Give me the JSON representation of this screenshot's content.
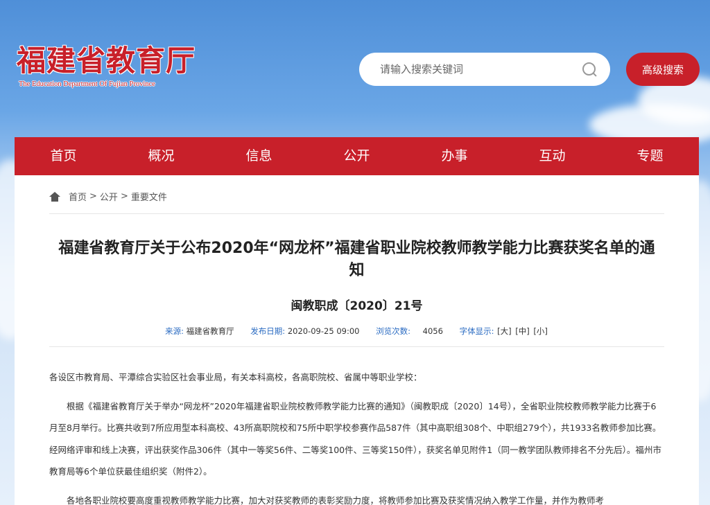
{
  "header": {
    "logo_cn": "福建省教育厅",
    "logo_en": "The Education Department Of Fujian Province",
    "search_placeholder": "请输入搜索关键词",
    "advanced_search_label": "高级搜索"
  },
  "nav": {
    "items": [
      "首页",
      "概况",
      "信息",
      "公开",
      "办事",
      "互动",
      "专题"
    ]
  },
  "breadcrumb": {
    "items": [
      "首页",
      "公开",
      "重要文件"
    ]
  },
  "article": {
    "title": "福建省教育厅关于公布2020年“网龙杯”福建省职业院校教师教学能力比赛获奖名单的通知",
    "doc_no": "闽教职成〔2020〕21号",
    "meta": {
      "source_label": "来源:",
      "source_value": "福建省教育厅",
      "date_label": "发布日期:",
      "date_value": "2020-09-25 09:00",
      "views_label": "浏览次数:",
      "views_value": "4056",
      "font_label": "字体显示:",
      "font_large": "[大]",
      "font_medium": "[中]",
      "font_small": "[小]"
    },
    "paragraphs": [
      "各设区市教育局、平潭综合实验区社会事业局，有关本科高校，各高职院校、省属中等职业学校：",
      "根据《福建省教育厅关于举办“网龙杯”2020年福建省职业院校教师教学能力比赛的通知》（闽教职成〔2020〕14号），全省职业院校教师教学能力比赛于6月至8月举行。比赛共收到7所应用型本科高校、43所高职院校和75所中职学校参赛作品587件（其中高职组308个、中职组279个），共1933名教师参加比赛。经网络评审和线上决赛，评出获奖作品306件（其中一等奖56件、二等奖100件、三等奖150件），获奖名单见附件1（同一教学团队教师排名不分先后）。福州市教育局等6个单位获最佳组织奖（附件2）。",
      "各地各职业院校要高度重视教师教学能力比赛，加大对获奖教师的表彰奖励力度，将教师参加比赛及获奖情况纳入教学工作量，并作为教师考"
    ]
  }
}
